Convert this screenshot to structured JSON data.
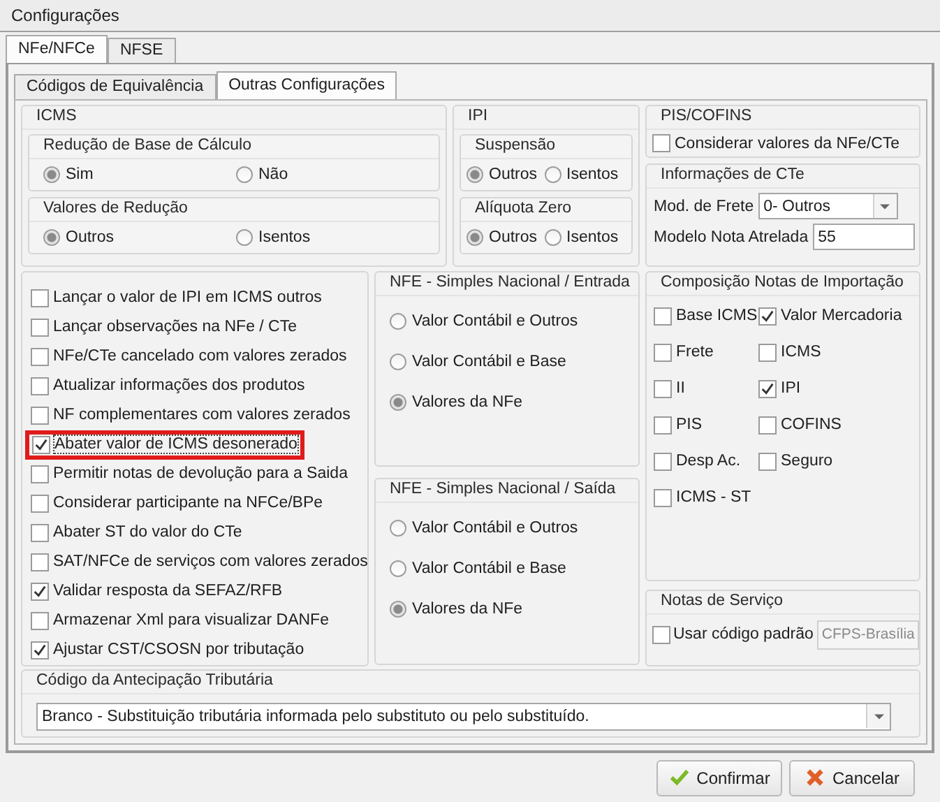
{
  "window": {
    "title": "Configurações"
  },
  "outer_tabs": [
    {
      "label": "NFe/NFCe",
      "selected": true
    },
    {
      "label": "NFSE",
      "selected": false
    }
  ],
  "inner_tabs": [
    {
      "label": "Códigos de Equivalência",
      "selected": false
    },
    {
      "label": "Outras Configurações",
      "selected": true
    }
  ],
  "icms": {
    "title": "ICMS",
    "groups": [
      {
        "title": "Redução de Base de Cálculo",
        "options": [
          {
            "label": "Sim",
            "selected": true
          },
          {
            "label": "Não",
            "selected": false
          }
        ]
      },
      {
        "title": "Valores de Redução",
        "options": [
          {
            "label": "Outros",
            "selected": true
          },
          {
            "label": "Isentos",
            "selected": false
          }
        ]
      }
    ]
  },
  "ipi": {
    "title": "IPI",
    "groups": [
      {
        "title": "Suspensão",
        "options": [
          {
            "label": "Outros",
            "selected": true
          },
          {
            "label": "Isentos",
            "selected": false
          }
        ]
      },
      {
        "title": "Alíquota Zero",
        "options": [
          {
            "label": "Outros",
            "selected": true
          },
          {
            "label": "Isentos",
            "selected": false
          }
        ]
      }
    ]
  },
  "pis_cofins": {
    "title": "PIS/COFINS",
    "checkbox": {
      "label": "Considerar valores da NFe/CTe",
      "checked": false
    }
  },
  "cte": {
    "title": "Informações de CTe",
    "mod_frete": {
      "label": "Mod. de Frete",
      "value": "0- Outros"
    },
    "modelo_nota": {
      "label": "Modelo Nota Atrelada",
      "value": "55"
    }
  },
  "options": [
    {
      "label": "Lançar o valor de IPI em ICMS outros",
      "checked": false,
      "highlighted": false
    },
    {
      "label": "Lançar observações na NFe / CTe",
      "checked": false,
      "highlighted": false
    },
    {
      "label": "NFe/CTe cancelado com valores zerados",
      "checked": false,
      "highlighted": false
    },
    {
      "label": "Atualizar informações dos produtos",
      "checked": false,
      "highlighted": false
    },
    {
      "label": "NF complementares com valores zerados",
      "checked": false,
      "highlighted": false
    },
    {
      "label": "Abater valor de ICMS desonerado",
      "checked": true,
      "highlighted": true
    },
    {
      "label": "Permitir notas de devolução para a Saida",
      "checked": false,
      "highlighted": false
    },
    {
      "label": "Considerar participante na NFCe/BPe",
      "checked": false,
      "highlighted": false
    },
    {
      "label": "Abater ST do valor do CTe",
      "checked": false,
      "highlighted": false
    },
    {
      "label": "SAT/NFCe de serviços com valores zerados",
      "checked": false,
      "highlighted": false
    },
    {
      "label": "Validar resposta da SEFAZ/RFB",
      "checked": true,
      "highlighted": false
    },
    {
      "label": "Armazenar Xml para visualizar DANFe",
      "checked": false,
      "highlighted": false
    },
    {
      "label": "Ajustar CST/CSOSN por tributação",
      "checked": true,
      "highlighted": false
    }
  ],
  "simples_entrada": {
    "title": "NFE - Simples Nacional / Entrada",
    "options": [
      {
        "label": "Valor Contábil e Outros",
        "selected": false
      },
      {
        "label": "Valor Contábil e Base",
        "selected": false
      },
      {
        "label": "Valores da NFe",
        "selected": true
      }
    ]
  },
  "simples_saida": {
    "title": "NFE - Simples Nacional / Saída",
    "options": [
      {
        "label": "Valor Contábil e Outros",
        "selected": false
      },
      {
        "label": "Valor Contábil e Base",
        "selected": false
      },
      {
        "label": "Valores da NFe",
        "selected": true
      }
    ]
  },
  "composicao": {
    "title": "Composição Notas de Importação",
    "items": [
      {
        "label": "Base ICMS",
        "checked": false
      },
      {
        "label": "Valor Mercadoria",
        "checked": true
      },
      {
        "label": "Frete",
        "checked": false
      },
      {
        "label": "ICMS",
        "checked": false
      },
      {
        "label": "II",
        "checked": false
      },
      {
        "label": "IPI",
        "checked": true
      },
      {
        "label": "PIS",
        "checked": false
      },
      {
        "label": "COFINS",
        "checked": false
      },
      {
        "label": "Desp Ac.",
        "checked": false
      },
      {
        "label": "Seguro",
        "checked": false
      },
      {
        "label": "ICMS - ST",
        "checked": false
      }
    ]
  },
  "notas_servico": {
    "title": "Notas de Serviço",
    "checkbox": {
      "label": "Usar código padrão",
      "checked": false
    },
    "code": {
      "value": "CFPS-Brasília",
      "disabled": true
    }
  },
  "antecipacao": {
    "title": "Código da Antecipação Tributária",
    "value": "Branco - Substituição tributária informada pelo substituto ou pelo substituído."
  },
  "buttons": [
    {
      "label": "Confirmar",
      "kind": "confirm"
    },
    {
      "label": "Cancelar",
      "kind": "cancel"
    }
  ]
}
